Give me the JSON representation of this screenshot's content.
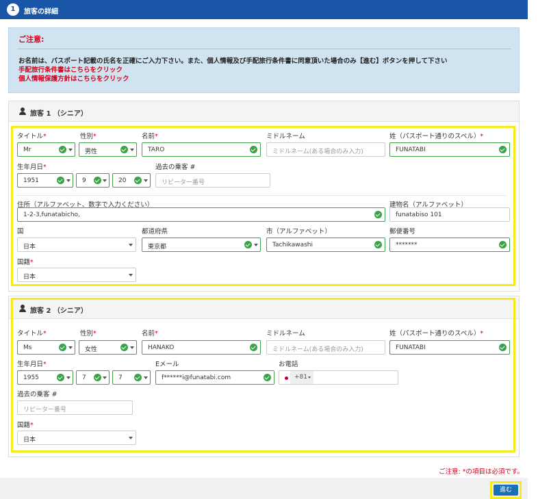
{
  "header": {
    "step": "1",
    "title": "旅客の詳細"
  },
  "notice": {
    "title": "ご注意:",
    "text": "お名前は、パスポート記載の氏名を正確にご入力下さい。また、個人情報及び手配旅行条件書に同意頂いた場合のみ【進む】ボタンを押して下さい",
    "link_terms": "手配旅行条件書はこちらをクリック",
    "link_privacy": "個人情報保護方針はこちらをクリック"
  },
  "required_mark": "*",
  "labels": {
    "title": "タイトル",
    "gender": "性別",
    "first_name": "名前",
    "middle_name": "ミドルネーム",
    "last_name": "姓（パスポート通りのスペル）",
    "birth_date": "生年月日",
    "past_passenger": "過去の乗客 #",
    "address": "住所（アルファベット、数字で入力ください）",
    "building": "建物名（アルファベット）",
    "country": "国",
    "prefecture": "都道府県",
    "city": "市（アルファベット）",
    "postal": "郵便番号",
    "nationality": "国籍",
    "email": "Eメール",
    "phone": "お電話"
  },
  "placeholders": {
    "middle_name": "ミドルネーム(ある場合のみ入力)",
    "repeater": "リピーター番号"
  },
  "passenger1": {
    "heading": "旅客 1 （シニア）",
    "title": "Mr",
    "gender": "男性",
    "first_name": "TARO",
    "last_name": "FUNATABI",
    "birth_year": "1951",
    "birth_month": "9",
    "birth_day": "20",
    "address": "1-2-3,funatabicho,",
    "building": "funatabiso 101",
    "country": "日本",
    "prefecture": "東京都",
    "city": "Tachikawashi",
    "postal": "*******",
    "nationality": "日本"
  },
  "passenger2": {
    "heading": "旅客 2 （シニア）",
    "title": "Ms",
    "gender": "女性",
    "first_name": "HANAKO",
    "last_name": "FUNATABI",
    "birth_year": "1955",
    "birth_month": "7",
    "birth_day": "7",
    "email": "f******i@funatabi.com",
    "phone_code": "+81",
    "nationality": "日本"
  },
  "footer": {
    "note": "ご注意: *の項目は必須です。",
    "next_label": "進む"
  },
  "colors": {
    "header": "#1a56a8",
    "highlight": "#f5ea1c",
    "valid": "#3ca24a",
    "required": "#d0021b"
  }
}
